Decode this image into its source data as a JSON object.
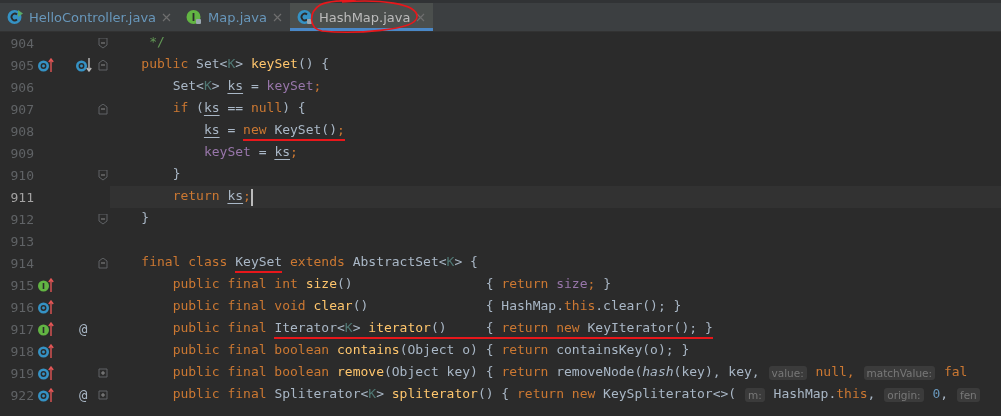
{
  "tabs": [
    {
      "label": "HelloController.java",
      "kind": "runnable-class",
      "selected": false,
      "annotated": false
    },
    {
      "label": "Map.java",
      "kind": "interface",
      "selected": false,
      "annotated": false
    },
    {
      "label": "HashMap.java",
      "kind": "class",
      "selected": true,
      "annotated": true
    }
  ],
  "lines": [
    {
      "number": "904",
      "current": false,
      "fold": {
        "kind": "close"
      },
      "tokens": [
        {
          "kind": "comment",
          "text": "     */"
        }
      ]
    },
    {
      "number": "905",
      "current": false,
      "gutter": [
        {
          "kind": "overrides"
        },
        {
          "kind": "overridden"
        }
      ],
      "fold": {
        "kind": "open"
      },
      "tokens": [
        {
          "kind": "keyword",
          "text": "    public "
        },
        {
          "kind": "plain",
          "text": "Set<"
        },
        {
          "kind": "type-param",
          "text": "K"
        },
        {
          "kind": "plain",
          "text": "> "
        },
        {
          "kind": "method",
          "text": "keySet"
        },
        {
          "kind": "plain",
          "text": "() {"
        }
      ]
    },
    {
      "number": "906",
      "current": false,
      "tokens": [
        {
          "kind": "plain",
          "text": "        Set<"
        },
        {
          "kind": "type-param",
          "text": "K"
        },
        {
          "kind": "plain",
          "text": "> "
        },
        {
          "kind": "variable",
          "text": "ks"
        },
        {
          "kind": "plain",
          "text": " = "
        },
        {
          "kind": "field",
          "text": "keySet"
        },
        {
          "kind": "keyword",
          "text": ";"
        }
      ]
    },
    {
      "number": "907",
      "current": false,
      "fold": {
        "kind": "open"
      },
      "tokens": [
        {
          "kind": "keyword",
          "text": "        if "
        },
        {
          "kind": "plain",
          "text": "("
        },
        {
          "kind": "variable",
          "text": "ks"
        },
        {
          "kind": "plain",
          "text": " == "
        },
        {
          "kind": "keyword",
          "text": "null"
        },
        {
          "kind": "plain",
          "text": ") {"
        }
      ]
    },
    {
      "number": "908",
      "current": false,
      "tokens": [
        {
          "kind": "variable",
          "text": "            ks"
        },
        {
          "kind": "plain",
          "text": " = "
        },
        {
          "kind": "keyword",
          "text": "new ",
          "marked": true
        },
        {
          "kind": "plain",
          "text": "KeySet()",
          "marked": true
        },
        {
          "kind": "keyword",
          "text": ";",
          "marked": true
        }
      ]
    },
    {
      "number": "909",
      "current": false,
      "tokens": [
        {
          "kind": "field",
          "text": "            keySet"
        },
        {
          "kind": "plain",
          "text": " = "
        },
        {
          "kind": "variable",
          "text": "ks"
        },
        {
          "kind": "keyword",
          "text": ";"
        }
      ]
    },
    {
      "number": "910",
      "current": false,
      "fold": {
        "kind": "close"
      },
      "tokens": [
        {
          "kind": "plain",
          "text": "        }"
        }
      ]
    },
    {
      "number": "911",
      "current": true,
      "tokens": [
        {
          "kind": "keyword",
          "text": "        return "
        },
        {
          "kind": "variable",
          "text": "ks"
        },
        {
          "kind": "keyword",
          "text": ";"
        }
      ]
    },
    {
      "number": "912",
      "current": false,
      "fold": {
        "kind": "close"
      },
      "tokens": [
        {
          "kind": "plain",
          "text": "    }"
        }
      ]
    },
    {
      "number": "913",
      "current": false
    },
    {
      "number": "914",
      "current": false,
      "fold": {
        "kind": "open"
      },
      "tokens": [
        {
          "kind": "keyword",
          "text": "    final class "
        },
        {
          "kind": "plain",
          "text": "KeySet",
          "marked": true
        },
        {
          "kind": "keyword",
          "text": " extends "
        },
        {
          "kind": "plain",
          "text": "AbstractSet<"
        },
        {
          "kind": "type-param",
          "text": "K"
        },
        {
          "kind": "plain",
          "text": "> {"
        }
      ]
    },
    {
      "number": "915",
      "current": false,
      "gutter": [
        {
          "kind": "implements"
        }
      ],
      "tokens": [
        {
          "kind": "keyword",
          "text": "        public final int "
        },
        {
          "kind": "method",
          "text": "size"
        },
        {
          "kind": "plain",
          "text": "()                 { "
        },
        {
          "kind": "keyword",
          "text": "return "
        },
        {
          "kind": "field",
          "text": "size"
        },
        {
          "kind": "keyword",
          "text": "; "
        },
        {
          "kind": "plain",
          "text": "}"
        }
      ]
    },
    {
      "number": "916",
      "current": false,
      "gutter": [
        {
          "kind": "overrides"
        }
      ],
      "tokens": [
        {
          "kind": "keyword",
          "text": "        public final void "
        },
        {
          "kind": "method",
          "text": "clear"
        },
        {
          "kind": "plain",
          "text": "()               { HashMap."
        },
        {
          "kind": "keyword",
          "text": "this"
        },
        {
          "kind": "plain",
          "text": ".clear(); }"
        }
      ]
    },
    {
      "number": "917",
      "current": false,
      "gutter": [
        {
          "kind": "implements"
        }
      ],
      "marker": "@",
      "tokens": [
        {
          "kind": "keyword",
          "text": "        public final "
        },
        {
          "kind": "plain",
          "text": "Iterator<",
          "marked": true
        },
        {
          "kind": "type-param",
          "text": "K",
          "marked": true
        },
        {
          "kind": "plain",
          "text": "> ",
          "marked": true
        },
        {
          "kind": "method",
          "text": "iterator",
          "marked": true
        },
        {
          "kind": "plain",
          "text": "()     { ",
          "marked": true
        },
        {
          "kind": "keyword",
          "text": "return new ",
          "marked": true
        },
        {
          "kind": "plain",
          "text": "KeyIterator(); }",
          "marked": true
        }
      ]
    },
    {
      "number": "918",
      "current": false,
      "gutter": [
        {
          "kind": "overrides"
        }
      ],
      "tokens": [
        {
          "kind": "keyword",
          "text": "        public final boolean "
        },
        {
          "kind": "method",
          "text": "contains"
        },
        {
          "kind": "plain",
          "text": "(Object o) { "
        },
        {
          "kind": "keyword",
          "text": "return "
        },
        {
          "kind": "plain",
          "text": "containsKey(o); }"
        }
      ]
    },
    {
      "number": "919",
      "current": false,
      "gutter": [
        {
          "kind": "overrides"
        }
      ],
      "fold": {
        "kind": "collapsed"
      },
      "tokens": [
        {
          "kind": "keyword",
          "text": "        public final boolean "
        },
        {
          "kind": "method",
          "text": "remove"
        },
        {
          "kind": "plain",
          "text": "(Object key) { "
        },
        {
          "kind": "keyword",
          "text": "return "
        },
        {
          "kind": "plain",
          "text": "removeNode("
        },
        {
          "kind": "static",
          "text": "hash"
        },
        {
          "kind": "plain",
          "text": "(key), key, "
        },
        {
          "kind": "hint",
          "text": "value:"
        },
        {
          "kind": "keyword",
          "text": " null, "
        },
        {
          "kind": "hint",
          "text": "matchValue:"
        },
        {
          "kind": "keyword",
          "text": " fal"
        }
      ]
    },
    {
      "number": "922",
      "current": false,
      "gutter": [
        {
          "kind": "overrides"
        }
      ],
      "marker": "@",
      "fold": {
        "kind": "collapsed"
      },
      "tokens": [
        {
          "kind": "keyword",
          "text": "        public final "
        },
        {
          "kind": "plain",
          "text": "Spliterator<"
        },
        {
          "kind": "type-param",
          "text": "K"
        },
        {
          "kind": "plain",
          "text": "> "
        },
        {
          "kind": "method",
          "text": "spliterator"
        },
        {
          "kind": "plain",
          "text": "() { "
        },
        {
          "kind": "keyword",
          "text": "return new "
        },
        {
          "kind": "plain",
          "text": "KeySpliterator<>( "
        },
        {
          "kind": "hint",
          "text": "m:"
        },
        {
          "kind": "plain",
          "text": " HashMap."
        },
        {
          "kind": "keyword",
          "text": "this"
        },
        {
          "kind": "plain",
          "text": ", "
        },
        {
          "kind": "hint",
          "text": "origin:"
        },
        {
          "kind": "number",
          "text": " 0"
        },
        {
          "kind": "plain",
          "text": ", "
        },
        {
          "kind": "hint",
          "text": "fen"
        }
      ]
    }
  ]
}
